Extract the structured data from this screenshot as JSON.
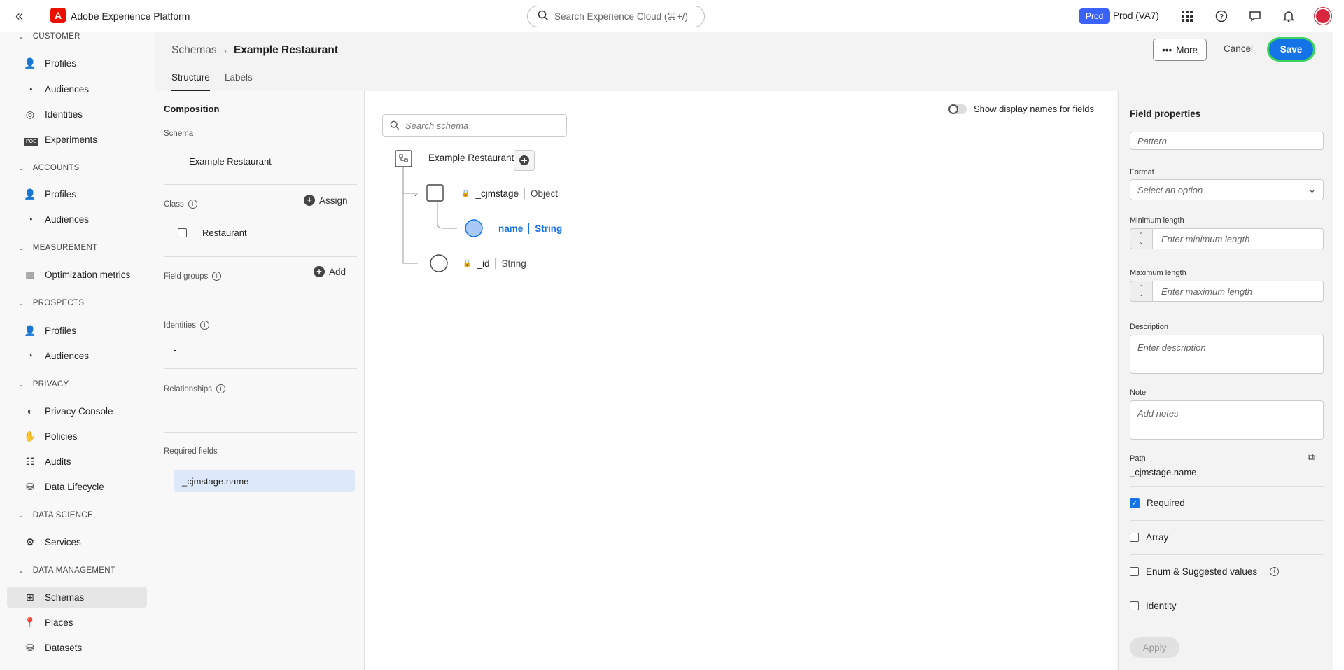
{
  "topbar": {
    "app_title": "Adobe Experience Platform",
    "search_placeholder": "Search Experience Cloud (⌘+/)",
    "org_badge": "Prod",
    "org_label": "Prod (VA7)"
  },
  "nav": {
    "sections": [
      {
        "label": "CUSTOMER",
        "items": [
          "Profiles",
          "Audiences",
          "Identities",
          "Experiments"
        ]
      },
      {
        "label": "ACCOUNTS",
        "items": [
          "Profiles",
          "Audiences"
        ]
      },
      {
        "label": "MEASUREMENT",
        "items": [
          "Optimization metrics"
        ]
      },
      {
        "label": "PROSPECTS",
        "items": [
          "Profiles",
          "Audiences"
        ]
      },
      {
        "label": "PRIVACY",
        "items": [
          "Privacy Console",
          "Policies",
          "Audits",
          "Data Lifecycle"
        ]
      },
      {
        "label": "DATA SCIENCE",
        "items": [
          "Services"
        ]
      },
      {
        "label": "DATA MANAGEMENT",
        "items": [
          "Schemas",
          "Places",
          "Datasets"
        ]
      }
    ],
    "poc_badge": "POC"
  },
  "header": {
    "breadcrumb_parent": "Schemas",
    "breadcrumb_current": "Example Restaurant",
    "tabs": [
      "Structure",
      "Labels"
    ],
    "more_label": "More",
    "cancel_label": "Cancel",
    "save_label": "Save"
  },
  "composition": {
    "title": "Composition",
    "schema_label": "Schema",
    "schema_value": "Example Restaurant",
    "class_label": "Class",
    "assign_label": "Assign",
    "class_value": "Restaurant",
    "field_groups_label": "Field groups",
    "add_label": "Add",
    "identities_label": "Identities",
    "identities_value": "-",
    "relationships_label": "Relationships",
    "relationships_value": "-",
    "required_fields_label": "Required fields",
    "required_field": "_cjmstage.name"
  },
  "canvas": {
    "toggle_label": "Show display names for fields",
    "search_placeholder": "Search schema",
    "root": "Example Restaurant",
    "nodes": [
      {
        "name": "_cjmstage",
        "type": "Object"
      },
      {
        "name": "name",
        "type": "String"
      },
      {
        "name": "_id",
        "type": "String"
      }
    ]
  },
  "field_properties": {
    "title": "Field properties",
    "pattern_placeholder": "Pattern",
    "format_label": "Format",
    "format_placeholder": "Select an option",
    "min_length_label": "Minimum length",
    "min_length_placeholder": "Enter minimum length",
    "max_length_label": "Maximum length",
    "max_length_placeholder": "Enter maximum length",
    "description_label": "Description",
    "description_placeholder": "Enter description",
    "note_label": "Note",
    "note_placeholder": "Add notes",
    "path_label": "Path",
    "path_value": "_cjmstage.name",
    "checks": [
      {
        "label": "Required",
        "checked": true
      },
      {
        "label": "Array",
        "checked": false
      },
      {
        "label": "Enum & Suggested values",
        "checked": false
      },
      {
        "label": "Identity",
        "checked": false
      }
    ],
    "apply_label": "Apply"
  }
}
